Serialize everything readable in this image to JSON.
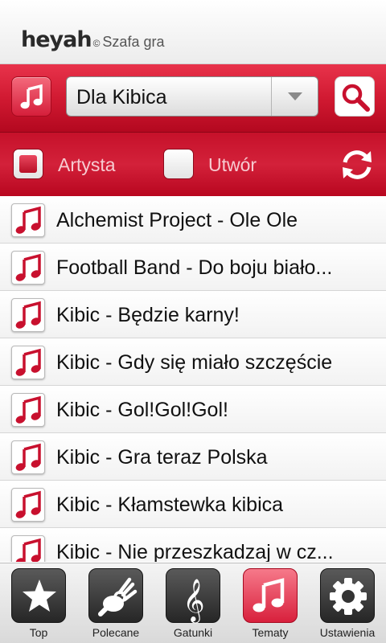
{
  "header": {
    "brand": "heyah",
    "brand_mark": "©",
    "app_name": "Szafa gra"
  },
  "search": {
    "category": "Dla Kibica"
  },
  "filters": {
    "artist_label": "Artysta",
    "artist_checked": true,
    "track_label": "Utwór",
    "track_checked": false
  },
  "songs": [
    "Alchemist Project - Ole Ole",
    "Football Band - Do boju biało...",
    "Kibic - Będzie karny!",
    "Kibic - Gdy się miało szczęście",
    "Kibic - Gol!Gol!Gol!",
    "Kibic - Gra teraz Polska",
    "Kibic - Kłamstewka kibica",
    "Kibic - Nie przeszkadzaj w cz..."
  ],
  "tabs": [
    {
      "label": "Top",
      "icon": "star-icon",
      "active": false
    },
    {
      "label": "Polecane",
      "icon": "hand-gesture-icon",
      "active": false
    },
    {
      "label": "Gatunki",
      "icon": "treble-clef-icon",
      "active": false
    },
    {
      "label": "Tematy",
      "icon": "music-note-icon",
      "active": true
    },
    {
      "label": "Ustawienia",
      "icon": "gear-icon",
      "active": false
    }
  ],
  "colors": {
    "accent": "#d11a32",
    "accent_dark": "#b3081f",
    "tab_dark": "#2e2e2e"
  }
}
